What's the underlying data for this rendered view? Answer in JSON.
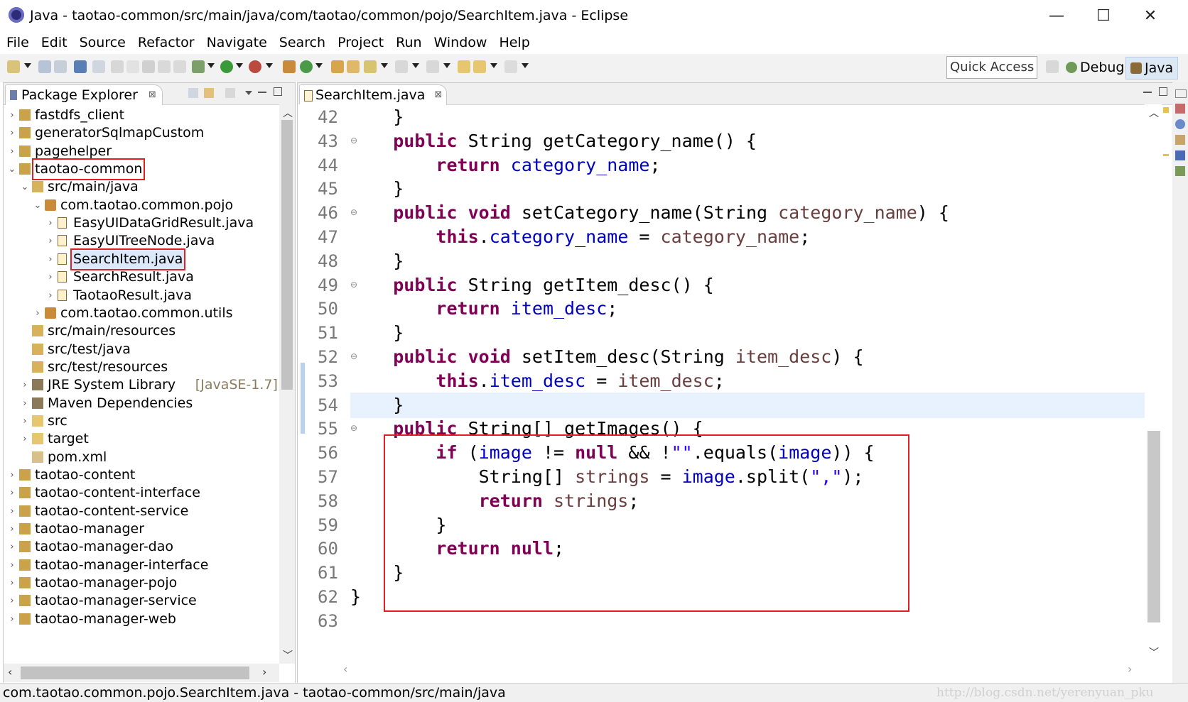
{
  "window": {
    "title": "Java - taotao-common/src/main/java/com/taotao/common/pojo/SearchItem.java - Eclipse",
    "minimize_glyph": "—",
    "maximize_glyph": "☐",
    "close_glyph": "✕"
  },
  "menu": [
    "File",
    "Edit",
    "Source",
    "Refactor",
    "Navigate",
    "Search",
    "Project",
    "Run",
    "Window",
    "Help"
  ],
  "toolbar": {
    "quick_access": "Quick Access",
    "perspectives": [
      "Debug",
      "Java"
    ]
  },
  "package_explorer": {
    "title": "Package Explorer",
    "close_glyph": "⊠",
    "items": [
      {
        "label": "fastdfs_client",
        "decor": "",
        "level": 0,
        "expanded": false,
        "icon": "maven-project-icon"
      },
      {
        "label": "generatorSqlmapCustom",
        "decor": "",
        "level": 0,
        "expanded": false,
        "icon": "maven-project-icon"
      },
      {
        "label": "pagehelper",
        "decor": "",
        "level": 0,
        "expanded": false,
        "icon": "maven-project-icon"
      },
      {
        "label": "taotao-common",
        "decor": "",
        "level": 0,
        "expanded": true,
        "icon": "maven-project-icon",
        "highlight": true
      },
      {
        "label": "src/main/java",
        "decor": "",
        "level": 1,
        "expanded": true,
        "icon": "source-folder-icon"
      },
      {
        "label": "com.taotao.common.pojo",
        "decor": "",
        "level": 2,
        "expanded": true,
        "icon": "package-icon"
      },
      {
        "label": "EasyUIDataGridResult.java",
        "decor": "",
        "level": 3,
        "expanded": false,
        "icon": "java-file-icon"
      },
      {
        "label": "EasyUITreeNode.java",
        "decor": "",
        "level": 3,
        "expanded": false,
        "icon": "java-file-icon"
      },
      {
        "label": "SearchItem.java",
        "decor": "",
        "level": 3,
        "expanded": false,
        "icon": "java-file-icon",
        "highlight": true,
        "selected": true
      },
      {
        "label": "SearchResult.java",
        "decor": "",
        "level": 3,
        "expanded": false,
        "icon": "java-file-icon"
      },
      {
        "label": "TaotaoResult.java",
        "decor": "",
        "level": 3,
        "expanded": false,
        "icon": "java-file-icon"
      },
      {
        "label": "com.taotao.common.utils",
        "decor": "",
        "level": 2,
        "expanded": false,
        "icon": "package-icon"
      },
      {
        "label": "src/main/resources",
        "decor": "",
        "level": 1,
        "expanded": null,
        "icon": "source-folder-icon"
      },
      {
        "label": "src/test/java",
        "decor": "",
        "level": 1,
        "expanded": null,
        "icon": "source-folder-icon"
      },
      {
        "label": "src/test/resources",
        "decor": "",
        "level": 1,
        "expanded": null,
        "icon": "source-folder-icon"
      },
      {
        "label": "JRE System Library",
        "decor": "[JavaSE-1.7]",
        "level": 1,
        "expanded": false,
        "icon": "library-icon"
      },
      {
        "label": "Maven Dependencies",
        "decor": "",
        "level": 1,
        "expanded": false,
        "icon": "library-icon"
      },
      {
        "label": "src",
        "decor": "",
        "level": 1,
        "expanded": false,
        "icon": "folder-icon"
      },
      {
        "label": "target",
        "decor": "",
        "level": 1,
        "expanded": false,
        "icon": "folder-icon"
      },
      {
        "label": "pom.xml",
        "decor": "",
        "level": 1,
        "expanded": null,
        "icon": "xml-file-icon"
      },
      {
        "label": "taotao-content",
        "decor": "",
        "level": 0,
        "expanded": false,
        "icon": "maven-project-icon"
      },
      {
        "label": "taotao-content-interface",
        "decor": "",
        "level": 0,
        "expanded": false,
        "icon": "maven-project-icon"
      },
      {
        "label": "taotao-content-service",
        "decor": "",
        "level": 0,
        "expanded": false,
        "icon": "maven-project-icon"
      },
      {
        "label": "taotao-manager",
        "decor": "",
        "level": 0,
        "expanded": false,
        "icon": "maven-project-icon"
      },
      {
        "label": "taotao-manager-dao",
        "decor": "",
        "level": 0,
        "expanded": false,
        "icon": "maven-project-icon"
      },
      {
        "label": "taotao-manager-interface",
        "decor": "",
        "level": 0,
        "expanded": false,
        "icon": "maven-project-icon"
      },
      {
        "label": "taotao-manager-pojo",
        "decor": "",
        "level": 0,
        "expanded": false,
        "icon": "maven-project-icon"
      },
      {
        "label": "taotao-manager-service",
        "decor": "",
        "level": 0,
        "expanded": false,
        "icon": "maven-project-icon"
      },
      {
        "label": "taotao-manager-web",
        "decor": "",
        "level": 0,
        "expanded": false,
        "icon": "maven-project-icon"
      }
    ]
  },
  "editor": {
    "tab_label": "SearchItem.java",
    "close_glyph": "⊠",
    "current_line": 54,
    "lines": [
      {
        "n": "42",
        "fold": false,
        "tokens": [
          [
            "    ",
            ""
          ],
          [
            "}",
            ""
          ]
        ]
      },
      {
        "n": "43",
        "fold": true,
        "tokens": [
          [
            "    ",
            ""
          ],
          [
            "public",
            "k"
          ],
          [
            " String getCategory_name() {",
            ""
          ]
        ]
      },
      {
        "n": "44",
        "fold": false,
        "tokens": [
          [
            "        ",
            ""
          ],
          [
            "return",
            "k"
          ],
          [
            " ",
            ""
          ],
          [
            "category_name",
            "f"
          ],
          [
            ";",
            ""
          ]
        ]
      },
      {
        "n": "45",
        "fold": false,
        "tokens": [
          [
            "    ",
            ""
          ],
          [
            "}",
            ""
          ]
        ]
      },
      {
        "n": "46",
        "fold": true,
        "tokens": [
          [
            "    ",
            ""
          ],
          [
            "public",
            "k"
          ],
          [
            " ",
            ""
          ],
          [
            "void",
            "k"
          ],
          [
            " setCategory_name(String ",
            ""
          ],
          [
            "category_name",
            "p"
          ],
          [
            ") {",
            ""
          ]
        ]
      },
      {
        "n": "47",
        "fold": false,
        "tokens": [
          [
            "        ",
            ""
          ],
          [
            "this",
            "k"
          ],
          [
            ".",
            ""
          ],
          [
            "category_name",
            "f"
          ],
          [
            " = ",
            ""
          ],
          [
            "category_name",
            "p"
          ],
          [
            ";",
            ""
          ]
        ]
      },
      {
        "n": "48",
        "fold": false,
        "tokens": [
          [
            "    ",
            ""
          ],
          [
            "}",
            ""
          ]
        ]
      },
      {
        "n": "49",
        "fold": true,
        "tokens": [
          [
            "    ",
            ""
          ],
          [
            "public",
            "k"
          ],
          [
            " String getItem_desc() {",
            ""
          ]
        ]
      },
      {
        "n": "50",
        "fold": false,
        "tokens": [
          [
            "        ",
            ""
          ],
          [
            "return",
            "k"
          ],
          [
            " ",
            ""
          ],
          [
            "item_desc",
            "f"
          ],
          [
            ";",
            ""
          ]
        ]
      },
      {
        "n": "51",
        "fold": false,
        "tokens": [
          [
            "    ",
            ""
          ],
          [
            "}",
            ""
          ]
        ]
      },
      {
        "n": "52",
        "fold": true,
        "tokens": [
          [
            "    ",
            ""
          ],
          [
            "public",
            "k"
          ],
          [
            " ",
            ""
          ],
          [
            "void",
            "k"
          ],
          [
            " setItem_desc(String ",
            ""
          ],
          [
            "item_desc",
            "p"
          ],
          [
            ") {",
            ""
          ]
        ]
      },
      {
        "n": "53",
        "fold": false,
        "tokens": [
          [
            "        ",
            ""
          ],
          [
            "this",
            "k"
          ],
          [
            ".",
            ""
          ],
          [
            "item_desc",
            "f"
          ],
          [
            " = ",
            ""
          ],
          [
            "item_desc",
            "p"
          ],
          [
            ";",
            ""
          ]
        ]
      },
      {
        "n": "54",
        "fold": false,
        "tokens": [
          [
            "    ",
            ""
          ],
          [
            "}",
            ""
          ]
        ]
      },
      {
        "n": "55",
        "fold": true,
        "tokens": [
          [
            "    ",
            ""
          ],
          [
            "public",
            "k"
          ],
          [
            " String[] getImages() {",
            ""
          ]
        ]
      },
      {
        "n": "56",
        "fold": false,
        "tokens": [
          [
            "        ",
            ""
          ],
          [
            "if",
            "k"
          ],
          [
            " (",
            ""
          ],
          [
            "image",
            "f"
          ],
          [
            " != ",
            ""
          ],
          [
            "null",
            "k"
          ],
          [
            " && !",
            ""
          ],
          [
            "\"\"",
            "s"
          ],
          [
            ".equals(",
            ""
          ],
          [
            "image",
            "f"
          ],
          [
            ")) {",
            ""
          ]
        ]
      },
      {
        "n": "57",
        "fold": false,
        "tokens": [
          [
            "            String[] ",
            ""
          ],
          [
            "strings",
            "p"
          ],
          [
            " = ",
            ""
          ],
          [
            "image",
            "f"
          ],
          [
            ".split(",
            ""
          ],
          [
            "\",\"",
            "s"
          ],
          [
            ");",
            ""
          ]
        ]
      },
      {
        "n": "58",
        "fold": false,
        "tokens": [
          [
            "            ",
            ""
          ],
          [
            "return",
            "k"
          ],
          [
            " ",
            ""
          ],
          [
            "strings",
            "p"
          ],
          [
            ";",
            ""
          ]
        ]
      },
      {
        "n": "59",
        "fold": false,
        "tokens": [
          [
            "        ",
            ""
          ],
          [
            "}",
            ""
          ]
        ]
      },
      {
        "n": "60",
        "fold": false,
        "tokens": [
          [
            "        ",
            ""
          ],
          [
            "return",
            "k"
          ],
          [
            " ",
            ""
          ],
          [
            "null",
            "k"
          ],
          [
            ";",
            ""
          ]
        ]
      },
      {
        "n": "61",
        "fold": false,
        "tokens": [
          [
            "    ",
            ""
          ],
          [
            "}",
            ""
          ]
        ]
      },
      {
        "n": "62",
        "fold": false,
        "tokens": [
          [
            "}",
            ""
          ]
        ]
      },
      {
        "n": "63",
        "fold": false,
        "tokens": [
          [
            "",
            ""
          ]
        ]
      }
    ]
  },
  "status": {
    "text": "com.taotao.common.pojo.SearchItem.java - taotao-common/src/main/java",
    "watermark": "http://blog.csdn.net/yerenyuan_pku"
  },
  "colors": {
    "keyword": "#7f0055",
    "field": "#0000c0",
    "parameter": "#6a3e3e",
    "string": "#2a00ff",
    "highlight_box": "#e02020",
    "current_line": "#e8f2fe"
  }
}
